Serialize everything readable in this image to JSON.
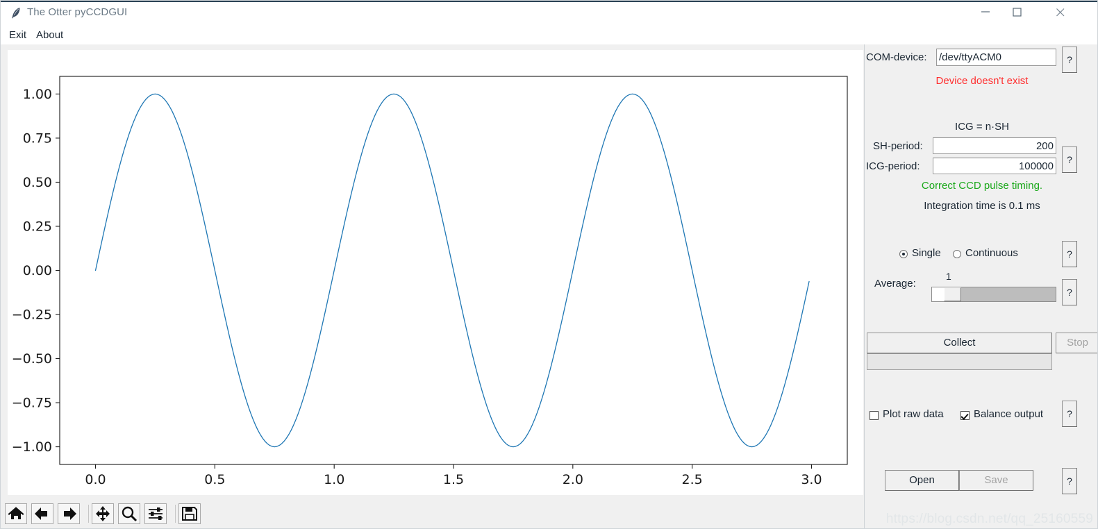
{
  "window": {
    "title": "The Otter pyCCDGUI",
    "icon": "feather-icon",
    "minimize_label": "Minimize",
    "maximize_label": "Maximize",
    "close_label": "Close"
  },
  "menu": {
    "items": [
      {
        "label": "Exit",
        "name": "menu-exit"
      },
      {
        "label": "About",
        "name": "menu-about"
      }
    ]
  },
  "toolbar": {
    "buttons": [
      {
        "name": "home-icon",
        "tip": "Reset original view"
      },
      {
        "name": "back-arrow-icon",
        "tip": "Back to previous view"
      },
      {
        "name": "forward-arrow-icon",
        "tip": "Forward to next view"
      },
      {
        "name": "pan-move-icon",
        "tip": "Pan axes"
      },
      {
        "name": "zoom-magnifier-icon",
        "tip": "Zoom to rectangle"
      },
      {
        "name": "configure-subplots-icon",
        "tip": "Configure subplots"
      },
      {
        "name": "save-floppy-icon",
        "tip": "Save the figure"
      }
    ]
  },
  "panel": {
    "com_device": {
      "label": "COM-device:",
      "value": "/dev/ttyACM0",
      "placeholder": "/dev/ttyACM0",
      "help_label": "?",
      "status": "Device doesn't exist",
      "status_color": "#ff2f2f"
    },
    "timing": {
      "formula": "ICG = n·SH",
      "sh_label": "SH-period:",
      "sh_value": "200",
      "icg_label": "ICG-period:",
      "icg_value": "100000",
      "help_label": "?",
      "status": "Correct CCD pulse timing.",
      "status_color": "#1aa81a",
      "integration": "Integration time is 0.1 ms",
      "integration_color": "#1b2733"
    },
    "mode": {
      "single_label": "Single",
      "single_selected": true,
      "continuous_label": "Continuous",
      "continuous_selected": false,
      "help_label": "?"
    },
    "average": {
      "label": "Average:",
      "value": "1",
      "help_label": "?"
    },
    "actions": {
      "collect_label": "Collect",
      "collect_enabled": true,
      "stop_label": "Stop",
      "stop_enabled": false,
      "progress_percent": 0
    },
    "options": {
      "plot_raw_label": "Plot raw data",
      "plot_raw_checked": false,
      "balance_label": "Balance output",
      "balance_checked": true,
      "help_label": "?"
    },
    "file": {
      "open_label": "Open",
      "open_enabled": true,
      "save_label": "Save",
      "save_enabled": false,
      "help_label": "?"
    }
  },
  "watermark": "https://blog.csdn.net/qq_25160559",
  "chart_data": {
    "type": "line",
    "title": "",
    "xlabel": "",
    "ylabel": "",
    "xlim": [
      -0.15,
      3.15
    ],
    "ylim": [
      -1.1,
      1.1
    ],
    "xticks": [
      "0.0",
      "0.5",
      "1.0",
      "1.5",
      "2.0",
      "2.5",
      "3.0"
    ],
    "xtick_values": [
      0.0,
      0.5,
      1.0,
      1.5,
      2.0,
      2.5,
      3.0
    ],
    "yticks": [
      "1.00",
      "0.75",
      "0.50",
      "0.25",
      "0.00",
      "−0.25",
      "−0.50",
      "−0.75",
      "−1.00"
    ],
    "ytick_values": [
      1.0,
      0.75,
      0.5,
      0.25,
      0.0,
      -0.25,
      -0.5,
      -0.75,
      -1.0
    ],
    "grid": false,
    "legend": null,
    "series": [
      {
        "name": "sine",
        "color": "#1f77b4",
        "linewidth": 1.3,
        "function": "sin(2*pi*x)",
        "x_start": 0.0,
        "x_end": 2.99,
        "x_step": 0.01,
        "amplitude": 1.0,
        "period": 1.0,
        "cycles": 3,
        "peaks_x": [
          0.25,
          1.25,
          2.25
        ],
        "peaks_y": [
          1.0,
          1.0,
          1.0
        ],
        "troughs_x": [
          0.75,
          1.75,
          2.75
        ],
        "troughs_y": [
          -1.0,
          -1.0,
          -1.0
        ],
        "endpoint_y": -0.0628
      }
    ]
  }
}
